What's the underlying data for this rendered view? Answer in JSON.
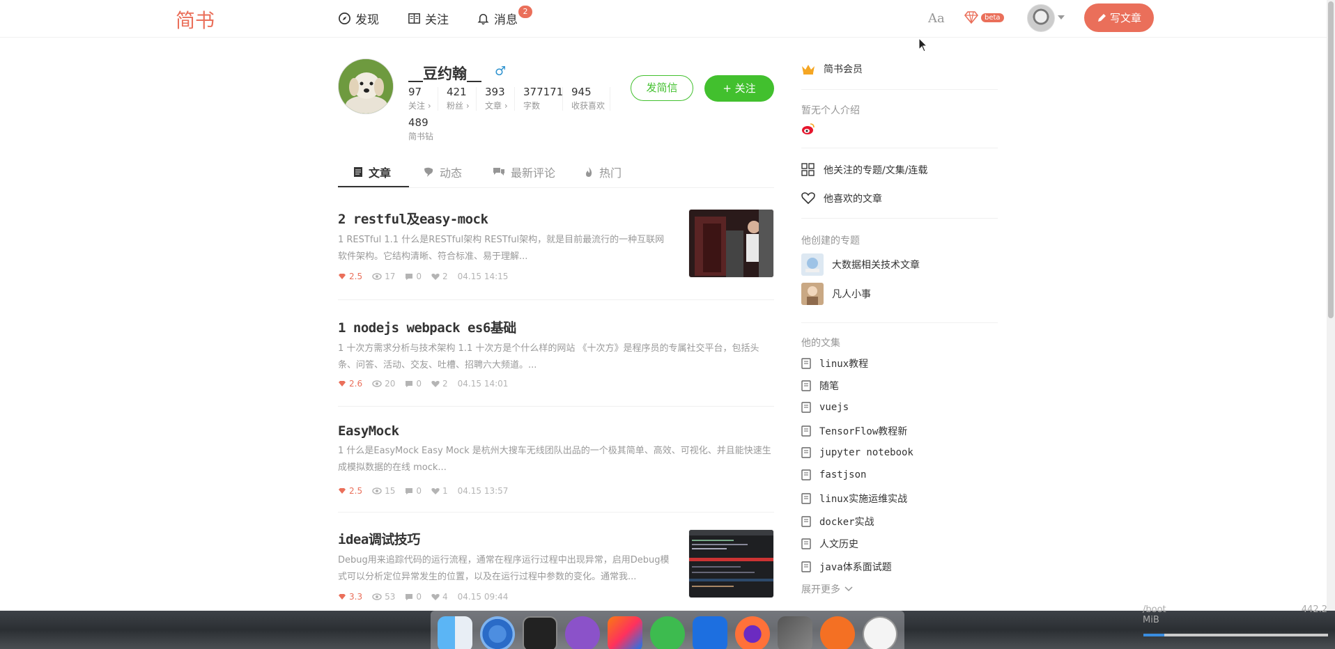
{
  "header": {
    "logo": "简书",
    "nav": [
      {
        "label": "发现",
        "icon": "compass-icon"
      },
      {
        "label": "关注",
        "icon": "book-icon"
      },
      {
        "label": "消息",
        "icon": "bell-icon"
      }
    ],
    "message_count": "2",
    "font_toggle": "Aa",
    "beta_label": "beta",
    "write_label": "写文章"
  },
  "profile": {
    "name": "__豆约翰__",
    "gender_symbol": "♂",
    "stats": [
      {
        "num": "97",
        "label": "关注 ›"
      },
      {
        "num": "421",
        "label": "粉丝 ›"
      },
      {
        "num": "393",
        "label": "文章 ›"
      },
      {
        "num": "377171",
        "label": "字数"
      },
      {
        "num": "945",
        "label": "收获喜欢"
      }
    ],
    "coins": {
      "num": "489",
      "label": "简书钻"
    },
    "msg_button": "发简信",
    "follow_button": "+ 关注"
  },
  "tabs": [
    {
      "label": "文章",
      "icon": "document-icon"
    },
    {
      "label": "动态",
      "icon": "chat-bubble-icon"
    },
    {
      "label": "最新评论",
      "icon": "comments-icon"
    },
    {
      "label": "热门",
      "icon": "fire-icon"
    }
  ],
  "articles": [
    {
      "title": "2 restful及easy-mock",
      "abstract": "1 RESTful 1.1 什么是RESTful架构  RESTful架构，就是目前最流行的一种互联网软件架构。它结构清晰、符合标准、易于理解...",
      "diamonds": "2.5",
      "views": "17",
      "comments": "0",
      "likes": "2",
      "time": "04.15 14:15"
    },
    {
      "title": "1 nodejs webpack es6基础",
      "abstract": "1 十次方需求分析与技术架构 1.1 十次方是个什么样的网站 《十次方》是程序员的专属社交平台，包括头条、问答、活动、交友、吐槽、招聘六大频道。...",
      "diamonds": "2.6",
      "views": "20",
      "comments": "0",
      "likes": "2",
      "time": "04.15 14:01"
    },
    {
      "title": "EasyMock",
      "abstract": "1 什么是EasyMock  Easy Mock 是杭州大搜车无线团队出品的一个极其简单、高效、可视化、并且能快速生成模拟数据的在线 mock...",
      "diamonds": "2.5",
      "views": "15",
      "comments": "0",
      "likes": "1",
      "time": "04.15 13:57"
    },
    {
      "title": "idea调试技巧",
      "abstract": "Debug用来追踪代码的运行流程，通常在程序运行过程中出现异常，启用Debug模式可以分析定位异常发生的位置，以及在运行过程中参数的变化。通常我...",
      "diamonds": "3.3",
      "views": "53",
      "comments": "0",
      "likes": "4",
      "time": "04.15 09:44"
    }
  ],
  "sidebar": {
    "vip": "简书会员",
    "no_intro": "暂无个人介绍",
    "followed_collections": "他关注的专题/文集/连载",
    "liked_articles": "他喜欢的文章",
    "created_topics_title": "他创建的专题",
    "topics": [
      "大数据相关技术文章",
      "凡人小事"
    ],
    "notebooks_title": "他的文集",
    "notebooks": [
      "linux教程",
      "随笔",
      "vuejs",
      "TensorFlow教程新",
      "jupyter notebook",
      "fastjson",
      "linux实施运维实战",
      "docker实战",
      "人文历史",
      "java体系面试题"
    ],
    "expand_more": "展开更多"
  },
  "desktop": {
    "sysmon_left": "/boot",
    "sysmon_right": "442.2 MiB",
    "dock_apps": [
      "finder-icon",
      "chromium-icon",
      "terminal-icon",
      "vscode-icon",
      "intellij-icon",
      "telegram-icon",
      "confluence-icon",
      "firefox-icon",
      "screenshot-icon",
      "postman-icon",
      "clock-icon"
    ]
  },
  "colors": {
    "brand": "#ea6f5a",
    "green": "#42c02e",
    "male": "#3194d0"
  }
}
